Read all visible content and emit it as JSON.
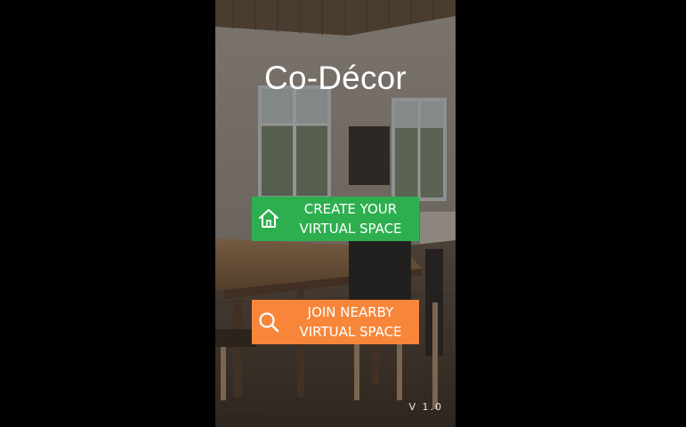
{
  "app": {
    "title": "Co-Décor",
    "version": "V 1.0"
  },
  "actions": {
    "create": {
      "line1": "CREATE YOUR",
      "line2": "VIRTUAL SPACE",
      "icon": "home-icon",
      "color": "#2eaf4f"
    },
    "join": {
      "line1": "JOIN NEARBY",
      "line2": "VIRTUAL SPACE",
      "icon": "search-icon",
      "color": "#f7863a"
    }
  },
  "colors": {
    "screen_outside": "#000000",
    "text": "#ffffff"
  }
}
